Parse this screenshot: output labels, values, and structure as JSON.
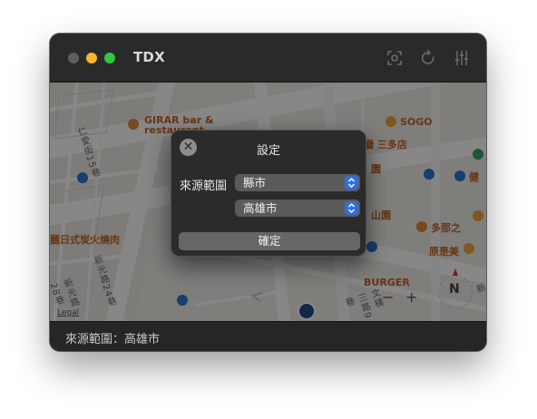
{
  "window": {
    "title": "TDX"
  },
  "toolbar": {
    "icons": [
      "screenshot-icon",
      "refresh-icon",
      "sliders-icon"
    ]
  },
  "map": {
    "labels": {
      "girar": "GIRAR bar &",
      "restaurant": "restaurant",
      "sogo": "SOGO",
      "italian": "洋城義大利餐廳 三多店",
      "park": "園",
      "mountain": "山園",
      "duona": "多那之",
      "yuan": "原是美",
      "bbq": "麗日式炭火燒肉",
      "burger": "BURGER",
      "jian": "健",
      "road_renai": "仁愛街15巷",
      "road_xinguang24": "新光路24巷",
      "road_xinguang28": "新光路28巷",
      "road_wenheng": "文橫三路9巷",
      "road_right": "新",
      "legal": "Legal"
    },
    "compass_label": "N",
    "zoom_out": "−",
    "zoom_in": "+"
  },
  "dialog": {
    "title": "設定",
    "close_glyph": "✕",
    "source_label": "來源範圍",
    "select_type": "縣市",
    "select_city": "高雄市",
    "confirm": "確定"
  },
  "status": {
    "text": "來源範圍：高雄市"
  },
  "colors": {
    "accent_blue": "#2f6fe0",
    "poi_orange": "#c4642a",
    "close_red": "#5e5e5e",
    "minimize_yellow": "#f6b92d",
    "maximize_green": "#2ec845"
  }
}
